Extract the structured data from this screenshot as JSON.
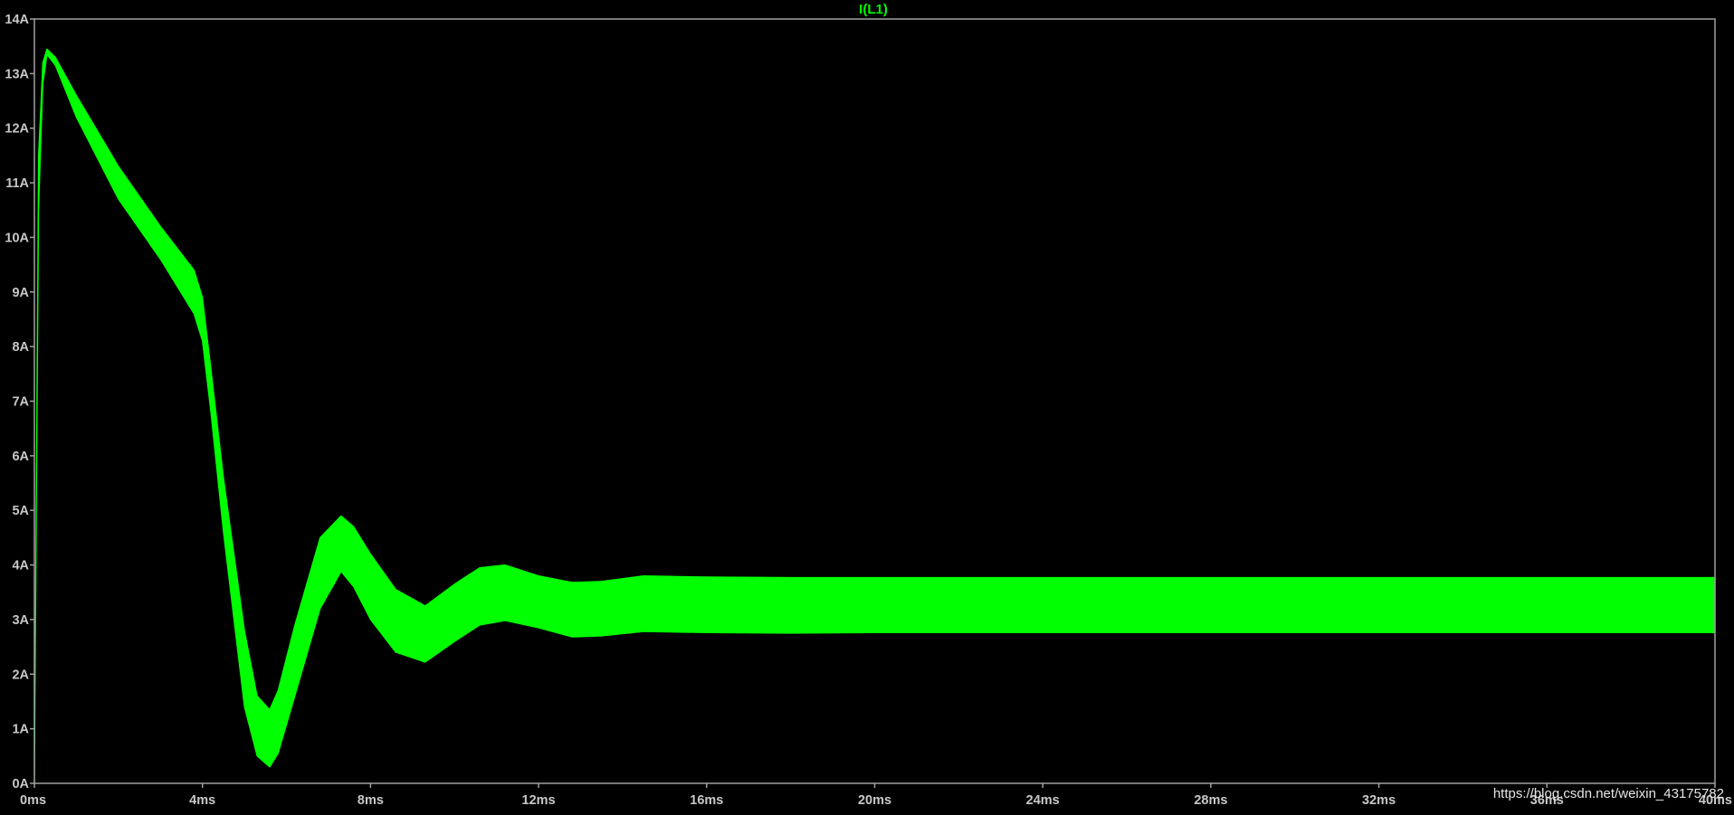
{
  "colors": {
    "background": "#000000",
    "axis": "#a0a0a0",
    "tick_text": "#c8c8c8",
    "trace": "#00ff00",
    "watermark": "#e6e6e6"
  },
  "watermark": "https://blog.csdn.net/weixin_43175782",
  "chart_data": {
    "type": "area",
    "title": "I(L1)",
    "xlabel": "",
    "ylabel": "",
    "x_unit": "ms",
    "y_unit": "A",
    "xlim": [
      0,
      40
    ],
    "ylim": [
      0,
      14
    ],
    "grid": false,
    "x_ticks": [
      "0ms",
      "4ms",
      "8ms",
      "12ms",
      "16ms",
      "20ms",
      "24ms",
      "28ms",
      "32ms",
      "36ms",
      "40ms"
    ],
    "y_ticks": [
      "0A",
      "1A",
      "2A",
      "3A",
      "4A",
      "5A",
      "6A",
      "7A",
      "8A",
      "9A",
      "10A",
      "11A",
      "12A",
      "13A",
      "14A"
    ],
    "series": [
      {
        "name": "I(L1)",
        "x": [
          0,
          0.1,
          0.2,
          0.3,
          0.5,
          1,
          2,
          3,
          3.8,
          4,
          4.2,
          4.5,
          5,
          5.3,
          5.6,
          5.8,
          6.2,
          6.8,
          7.3,
          7.6,
          8,
          8.6,
          9.3,
          10,
          10.6,
          11.2,
          12,
          12.8,
          13.5,
          14.5,
          16,
          18,
          20,
          24,
          28,
          32,
          36,
          40
        ],
        "upper": [
          0,
          11.5,
          13.2,
          13.45,
          13.3,
          12.6,
          11.3,
          10.2,
          9.4,
          8.9,
          7.6,
          5.6,
          2.8,
          1.6,
          1.35,
          1.7,
          2.9,
          4.5,
          4.9,
          4.7,
          4.2,
          3.55,
          3.25,
          3.65,
          3.95,
          4.0,
          3.8,
          3.68,
          3.7,
          3.8,
          3.78,
          3.77,
          3.77,
          3.77,
          3.77,
          3.77,
          3.77,
          3.77
        ],
        "lower": [
          0,
          10.5,
          12.8,
          13.35,
          13.15,
          12.2,
          10.7,
          9.6,
          8.6,
          8.1,
          6.8,
          4.6,
          1.4,
          0.5,
          0.3,
          0.55,
          1.6,
          3.2,
          3.88,
          3.6,
          3.0,
          2.4,
          2.22,
          2.6,
          2.9,
          2.98,
          2.85,
          2.68,
          2.7,
          2.78,
          2.76,
          2.75,
          2.76,
          2.76,
          2.76,
          2.76,
          2.76,
          2.76
        ]
      }
    ]
  }
}
